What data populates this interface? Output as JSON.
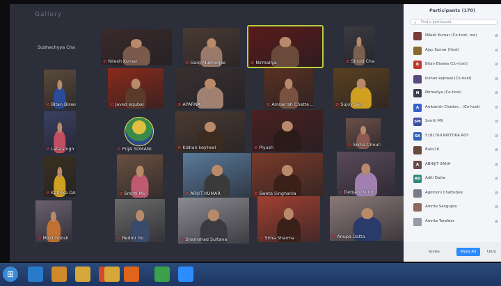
{
  "window": {
    "title": "Zoom"
  },
  "panel": {
    "title": "Participants (170)",
    "search_placeholder": "Find a participant",
    "participants": [
      {
        "initial": "",
        "name": "Nilesh Kumar (Co-host, me)",
        "color": "#7a3b3b"
      },
      {
        "initial": "",
        "name": "Ajay Kumar (Host)",
        "color": "#8a6a2a"
      },
      {
        "initial": "B",
        "name": "Bitan Biswas (Co-host)",
        "color": "#c0392b"
      },
      {
        "initial": "",
        "name": "kishan kejriwal (Co-host)",
        "color": "#5a4a7a"
      },
      {
        "initial": "N",
        "name": "Nirmallya (Co-host)",
        "color": "#3b3f4d"
      },
      {
        "initial": "A",
        "name": "Ambarish Chatter... (Co-host)",
        "color": "#3a63c9"
      },
      {
        "initial": "SM",
        "name": "Smriti MV",
        "color": "#3b4ea0"
      },
      {
        "initial": "SK",
        "name": "5181769 KRITTIKA ROY",
        "color": "#2f63b8"
      },
      {
        "initial": "",
        "name": "Baliv18",
        "color": "#6b4a3a"
      },
      {
        "initial": "A",
        "name": "ABHIJIT SAHA",
        "color": "#6a4a4a"
      },
      {
        "initial": "AD",
        "name": "Aditi Datta",
        "color": "#2e8b7a"
      },
      {
        "initial": "",
        "name": "Agomoni Chatterjee",
        "color": "#7a7a8a"
      },
      {
        "initial": "",
        "name": "Amrita Sengupta",
        "color": "#8a6a5a"
      },
      {
        "initial": "",
        "name": "Amrita Tarafdar",
        "color": "#9a9aa6"
      }
    ],
    "buttons": {
      "invite": "Invite",
      "mute_all": "Mute All",
      "more": "Unm"
    }
  },
  "gallery": {
    "header_label": "Gallery",
    "tiles": [
      {
        "name": "Subhechyya Cha",
        "video": false
      },
      {
        "name": "Nilesh Kumar",
        "video": true,
        "bg": "#3a2a2a",
        "skin": "#7a5a4a"
      },
      {
        "name": "Garg Mukherjee",
        "video": true,
        "bg": "#4a3a32",
        "skin": "#9a7a6a"
      },
      {
        "name": "Nirmallya",
        "video": true,
        "bg": "#5a1a1a",
        "skin": "#6a4a3a",
        "active": true
      },
      {
        "name": "Shruti Chandak",
        "video": true,
        "bg": "#3a3a40",
        "skin": "#7a6050"
      },
      {
        "name": "Bitan Biswas",
        "video": true,
        "bg": "#5a4a3a",
        "skin": "#2a4a9a"
      },
      {
        "name": "Javed equbal",
        "video": true,
        "bg": "#8a2a1a",
        "skin": "#5a3a2a"
      },
      {
        "name": "APARNA",
        "video": true,
        "bg": "#3a3030",
        "skin": "#a08070"
      },
      {
        "name": "Ambarish Chatte...",
        "video": true,
        "bg": "#5a3020",
        "skin": "#7a5040"
      },
      {
        "name": "Sujoy Sen",
        "video": true,
        "bg": "#5a4020",
        "skin": "#d0a020"
      },
      {
        "name": "Lata singh",
        "video": true,
        "bg": "#3a4060",
        "skin": "#c05060"
      },
      {
        "name": "PUJA SOMANI",
        "video": false,
        "avatar": true
      },
      {
        "name": "Kishan kejriwal",
        "video": true,
        "bg": "#4a3a30",
        "skin": "#3a2a20"
      },
      {
        "name": "Piyush",
        "video": true,
        "bg": "#4a2020",
        "skin": "#2a1a18"
      },
      {
        "name": "Sikha Chourasia",
        "video": true,
        "bg": "#6a5048",
        "skin": "#8a5a50"
      },
      {
        "name": "Kathika DASGUP...",
        "video": true,
        "bg": "#3a3020",
        "skin": "#d0a020"
      },
      {
        "name": "Smriti MV",
        "video": true,
        "bg": "#6a5040",
        "skin": "#c05a70"
      },
      {
        "name": "ARIJIT KUMAR",
        "video": true,
        "bg": "#5a7a9a",
        "skin": "#3a3a3a"
      },
      {
        "name": "Sweta Singhania",
        "video": true,
        "bg": "#7a3a28",
        "skin": "#3a2018"
      },
      {
        "name": "Debjani Kundu",
        "video": true,
        "bg": "#5a4a5a",
        "skin": "#a080b0"
      },
      {
        "name": "Misti Ghosh",
        "video": true,
        "bg": "#6a6070",
        "skin": "#c07030"
      },
      {
        "name": "Redmi Go",
        "video": true,
        "bg": "#6a6a6a",
        "skin": "#3a4a6a"
      },
      {
        "name": "Shamshad Sultana",
        "video": true,
        "bg": "#8a8a90",
        "skin": "#3a3a40"
      },
      {
        "name": "Sima Sharma",
        "video": true,
        "bg": "#a04030",
        "skin": "#3a2018"
      },
      {
        "name": "Anupa Datta",
        "video": true,
        "bg": "#8a7a78",
        "skin": "#2a3a6a"
      }
    ]
  },
  "taskbar": {
    "icons": [
      {
        "name": "start-icon",
        "color": "#3a8ad6"
      },
      {
        "name": "ie-icon",
        "color": "#2a7acb"
      },
      {
        "name": "media-icon",
        "color": "#d08a2a"
      },
      {
        "name": "folder-icon",
        "color": "#d6a83a"
      },
      {
        "name": "player-icon",
        "color": "#d04a2a"
      },
      {
        "name": "firefox-icon",
        "color": "#e0641a"
      },
      {
        "name": "explorer-icon",
        "color": "#d6a83a"
      },
      {
        "name": "chrome-icon",
        "color": "#3aa04a"
      },
      {
        "name": "zoom-icon",
        "color": "#2d8cff"
      }
    ]
  },
  "colors": {
    "active_speaker": "#b6d23d",
    "mute_red": "#e0474c",
    "zoom_blue": "#2d8cff"
  }
}
